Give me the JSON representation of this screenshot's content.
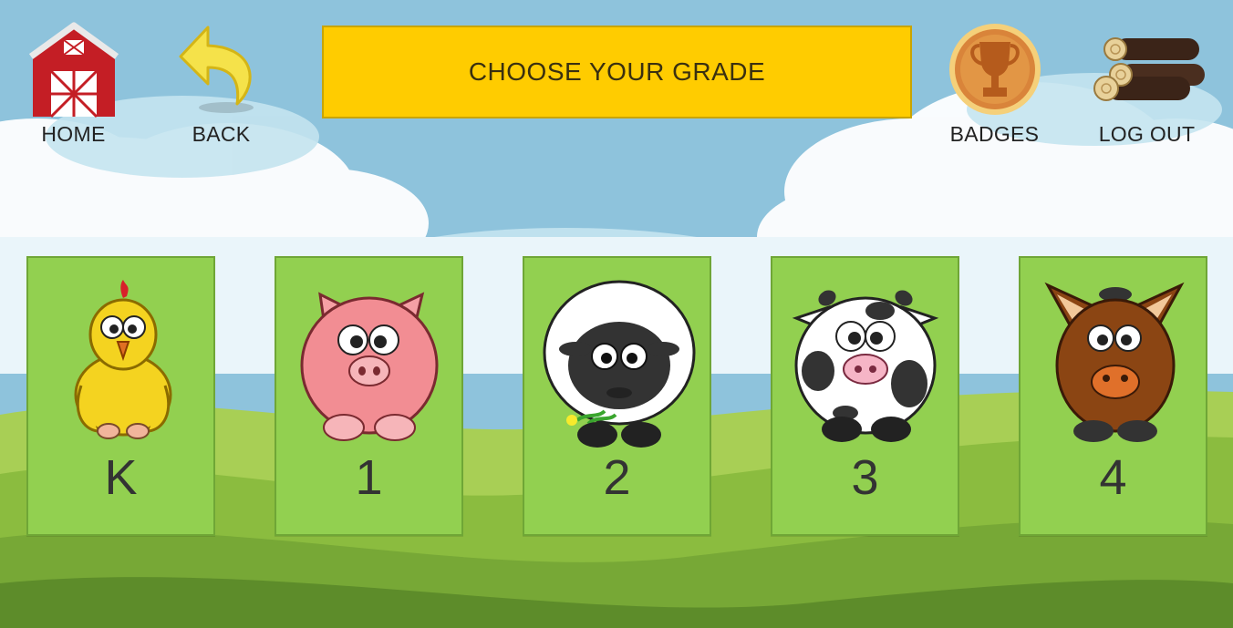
{
  "nav": {
    "home_label": "HOME",
    "back_label": "BACK",
    "badges_label": "BADGES",
    "logout_label": "LOG OUT"
  },
  "title": "CHOOSE YOUR GRADE",
  "grades": [
    {
      "label": "K",
      "animal": "chicken-icon"
    },
    {
      "label": "1",
      "animal": "pig-icon"
    },
    {
      "label": "2",
      "animal": "sheep-icon"
    },
    {
      "label": "3",
      "animal": "cow-icon"
    },
    {
      "label": "4",
      "animal": "horse-icon"
    }
  ],
  "colors": {
    "sky": "#8ec3dc",
    "title_bar": "#ffcc00",
    "card": "#92d050",
    "grass": "#8bbc3f"
  }
}
